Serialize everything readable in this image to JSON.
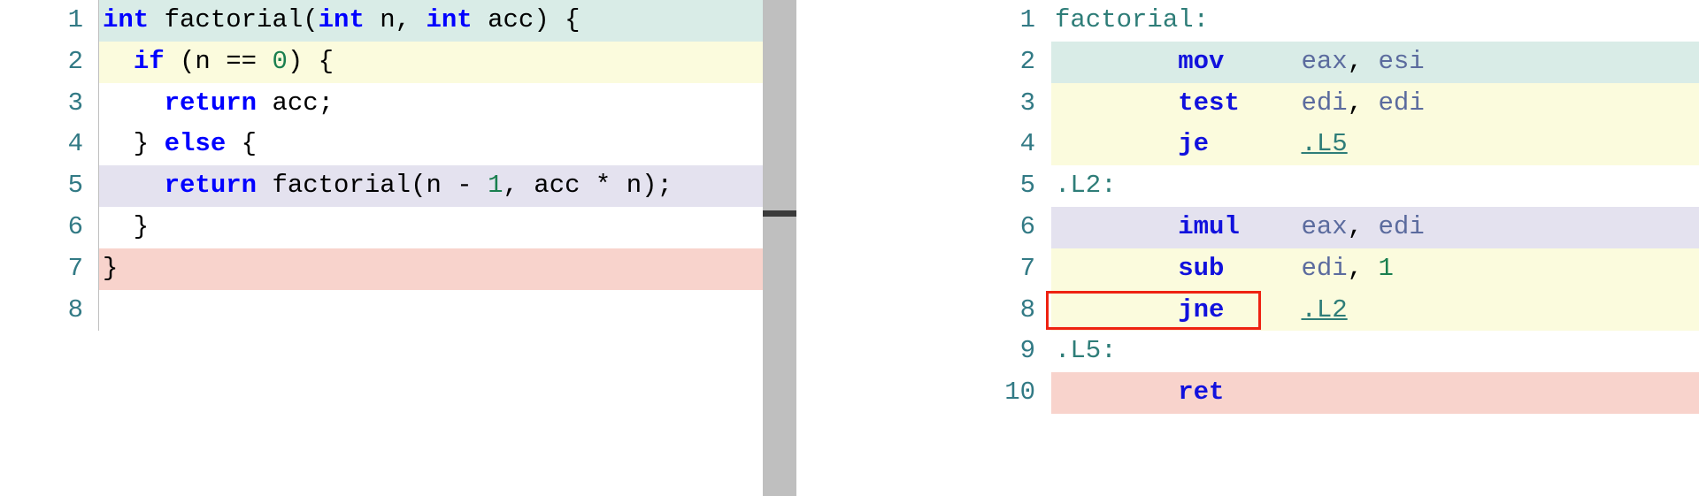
{
  "source_pane": {
    "name": "c-source-editor",
    "language": "C",
    "lines": [
      {
        "num": "1",
        "highlight": "#d9ece7",
        "tokens": [
          {
            "text": "int ",
            "cls": "t-type"
          },
          {
            "text": "factorial(",
            "cls": "t-plain"
          },
          {
            "text": "int ",
            "cls": "t-type"
          },
          {
            "text": "n, ",
            "cls": "t-plain"
          },
          {
            "text": "int ",
            "cls": "t-type"
          },
          {
            "text": "acc) {",
            "cls": "t-plain"
          }
        ],
        "plain": "int factorial(int n, int acc) {"
      },
      {
        "num": "2",
        "highlight": "#fbfbdd",
        "tokens": [
          {
            "text": "  ",
            "cls": "t-plain"
          },
          {
            "text": "if",
            "cls": "t-kw"
          },
          {
            "text": " (n == ",
            "cls": "t-plain"
          },
          {
            "text": "0",
            "cls": "t-num"
          },
          {
            "text": ") {",
            "cls": "t-plain"
          }
        ],
        "plain": "  if (n == 0) {"
      },
      {
        "num": "3",
        "highlight": "",
        "tokens": [
          {
            "text": "    ",
            "cls": "t-plain"
          },
          {
            "text": "return",
            "cls": "t-kw"
          },
          {
            "text": " acc;",
            "cls": "t-plain"
          }
        ],
        "plain": "    return acc;"
      },
      {
        "num": "4",
        "highlight": "",
        "tokens": [
          {
            "text": "  } ",
            "cls": "t-plain"
          },
          {
            "text": "else",
            "cls": "t-kw"
          },
          {
            "text": " {",
            "cls": "t-plain"
          }
        ],
        "plain": "  } else {"
      },
      {
        "num": "5",
        "highlight": "#e4e2ef",
        "tokens": [
          {
            "text": "    ",
            "cls": "t-plain"
          },
          {
            "text": "return",
            "cls": "t-kw"
          },
          {
            "text": " factorial(n - ",
            "cls": "t-plain"
          },
          {
            "text": "1",
            "cls": "t-num"
          },
          {
            "text": ", acc * n);",
            "cls": "t-plain"
          }
        ],
        "plain": "    return factorial(n - 1, acc * n);"
      },
      {
        "num": "6",
        "highlight": "",
        "tokens": [
          {
            "text": "  }",
            "cls": "t-plain"
          }
        ],
        "plain": "  }"
      },
      {
        "num": "7",
        "highlight": "#f8d3cc",
        "tokens": [
          {
            "text": "}",
            "cls": "t-plain"
          }
        ],
        "plain": "}"
      },
      {
        "num": "8",
        "highlight": "",
        "tokens": [
          {
            "text": "",
            "cls": "t-plain"
          }
        ],
        "plain": ""
      }
    ]
  },
  "asm_pane": {
    "name": "assembly-output",
    "language": "x86-64 asm",
    "lines": [
      {
        "num": "1",
        "highlight": "",
        "tokens": [
          {
            "text": "factorial:",
            "cls": "t-label"
          }
        ],
        "plain": "factorial:"
      },
      {
        "num": "2",
        "highlight": "#d9ece7",
        "tokens": [
          {
            "text": "        ",
            "cls": "t-plain"
          },
          {
            "text": "mov",
            "cls": "t-mn"
          },
          {
            "text": "     ",
            "cls": "t-plain"
          },
          {
            "text": "eax",
            "cls": "t-reg"
          },
          {
            "text": ", ",
            "cls": "t-plain"
          },
          {
            "text": "esi",
            "cls": "t-reg"
          }
        ],
        "plain": "        mov     eax, esi"
      },
      {
        "num": "3",
        "highlight": "#fbfbdd",
        "tokens": [
          {
            "text": "        ",
            "cls": "t-plain"
          },
          {
            "text": "test",
            "cls": "t-mn"
          },
          {
            "text": "    ",
            "cls": "t-plain"
          },
          {
            "text": "edi",
            "cls": "t-reg"
          },
          {
            "text": ", ",
            "cls": "t-plain"
          },
          {
            "text": "edi",
            "cls": "t-reg"
          }
        ],
        "plain": "        test    edi, edi"
      },
      {
        "num": "4",
        "highlight": "#fbfbdd",
        "tokens": [
          {
            "text": "        ",
            "cls": "t-plain"
          },
          {
            "text": "je",
            "cls": "t-mn"
          },
          {
            "text": "      ",
            "cls": "t-plain"
          },
          {
            "text": ".L5",
            "cls": "t-link"
          }
        ],
        "plain": "        je      .L5"
      },
      {
        "num": "5",
        "highlight": "",
        "tokens": [
          {
            "text": ".L2:",
            "cls": "t-label"
          }
        ],
        "plain": ".L2:"
      },
      {
        "num": "6",
        "highlight": "#e4e2ef",
        "tokens": [
          {
            "text": "        ",
            "cls": "t-plain"
          },
          {
            "text": "imul",
            "cls": "t-mn"
          },
          {
            "text": "    ",
            "cls": "t-plain"
          },
          {
            "text": "eax",
            "cls": "t-reg"
          },
          {
            "text": ", ",
            "cls": "t-plain"
          },
          {
            "text": "edi",
            "cls": "t-reg"
          }
        ],
        "plain": "        imul    eax, edi"
      },
      {
        "num": "7",
        "highlight": "#fbfbdd",
        "tokens": [
          {
            "text": "        ",
            "cls": "t-plain"
          },
          {
            "text": "sub",
            "cls": "t-mn"
          },
          {
            "text": "     ",
            "cls": "t-plain"
          },
          {
            "text": "edi",
            "cls": "t-reg"
          },
          {
            "text": ", ",
            "cls": "t-plain"
          },
          {
            "text": "1",
            "cls": "t-imm"
          }
        ],
        "plain": "        sub     edi, 1"
      },
      {
        "num": "8",
        "highlight": "#fbfbdd",
        "tokens": [
          {
            "text": "        ",
            "cls": "t-plain"
          },
          {
            "text": "jne",
            "cls": "t-mn"
          },
          {
            "text": "     ",
            "cls": "t-plain"
          },
          {
            "text": ".L2",
            "cls": "t-link"
          }
        ],
        "plain": "        jne     .L2"
      },
      {
        "num": "9",
        "highlight": "",
        "tokens": [
          {
            "text": ".L5:",
            "cls": "t-label"
          }
        ],
        "plain": ".L5:"
      },
      {
        "num": "10",
        "highlight": "#f8d3cc",
        "tokens": [
          {
            "text": "        ",
            "cls": "t-plain"
          },
          {
            "text": "ret",
            "cls": "t-mn"
          }
        ],
        "plain": "        ret"
      }
    ]
  },
  "annotation": {
    "name": "jne-l2-highlight-box",
    "target_line": "8",
    "target_text": "jne     .L2",
    "border_color": "#ee2211"
  },
  "splitter": {
    "name": "pane-splitter",
    "handle_color": "#3b3b3b",
    "track_color": "#bfbfbf"
  },
  "colors": {
    "highlight_teal": "#d9ece7",
    "highlight_yellow": "#fbfbdd",
    "highlight_lavender": "#e4e2ef",
    "highlight_pink": "#f8d3cc",
    "gutter_text": "#327a85",
    "keyword": "#0000ff",
    "number": "#1a7f4f",
    "label": "#2e7d78",
    "register": "#5b6b9e",
    "mnemonic": "#1111dd"
  }
}
